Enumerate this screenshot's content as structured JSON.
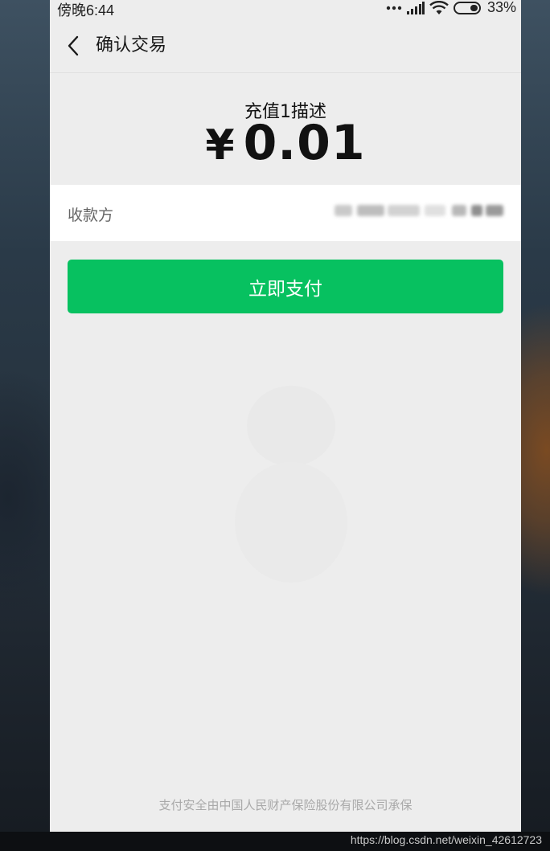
{
  "status_bar": {
    "time": "傍晚6:44",
    "battery": "33%",
    "icons": [
      "more-dots-icon",
      "signal-icon",
      "wifi-icon",
      "battery-icon"
    ]
  },
  "nav": {
    "back_icon": "chevron-left-icon",
    "title": "确认交易"
  },
  "payment": {
    "description": "充值1描述",
    "currency_symbol": "¥",
    "amount": "0.01"
  },
  "payee": {
    "label": "收款方",
    "value_redacted": true
  },
  "actions": {
    "pay_label": "立即支付"
  },
  "footer": {
    "text": "支付安全由中国人民财产保险股份有限公司承保"
  },
  "credit": "https://blog.csdn.net/weixin_42612723",
  "colors": {
    "accent": "#07c160",
    "screen_bg": "#ededed",
    "row_bg": "#ffffff"
  }
}
